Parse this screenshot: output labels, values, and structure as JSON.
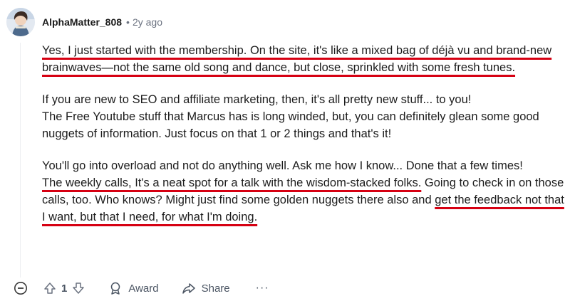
{
  "comment": {
    "author": "AlphaMatter_808",
    "separator": "•",
    "time": "2y ago",
    "paragraphs": [
      {
        "u1": "Yes, I just started with the membership. On the site, it's like a mixed bag of déjà vu and brand-new brainwaves—not the same old song and dance, but close, sprinkled with some fresh tunes."
      },
      {
        "line1": "If you are new to SEO and affiliate marketing, then, it's all pretty new stuff... to you!",
        "line2": "The Free Youtube stuff that Marcus has is long winded, but, you can definitely glean some good nuggets of information. Just focus on that 1 or 2 things and that's it!"
      },
      {
        "line1": "You'll go into overload and not do anything well. Ask me how I know... Done that a few times!",
        "u2": "The weekly calls, It's a neat spot for a talk with the wisdom-stacked folks.",
        "plain": " Going to check in on those calls, too. Who knows? Might just find some golden nuggets there also and ",
        "u3": "get the feedback not that I want, but that I need, for what I'm doing."
      }
    ]
  },
  "actions": {
    "vote_count": "1",
    "award_label": "Award",
    "share_label": "Share",
    "more_label": "···"
  },
  "icons": {
    "collapse": "collapse-minus-icon",
    "upvote": "upvote-arrow-icon",
    "downvote": "downvote-arrow-icon",
    "award": "award-icon",
    "share": "share-arrow-icon",
    "more": "more-dots-icon"
  },
  "colors": {
    "underline": "#d60012",
    "muted": "#6b7280"
  }
}
